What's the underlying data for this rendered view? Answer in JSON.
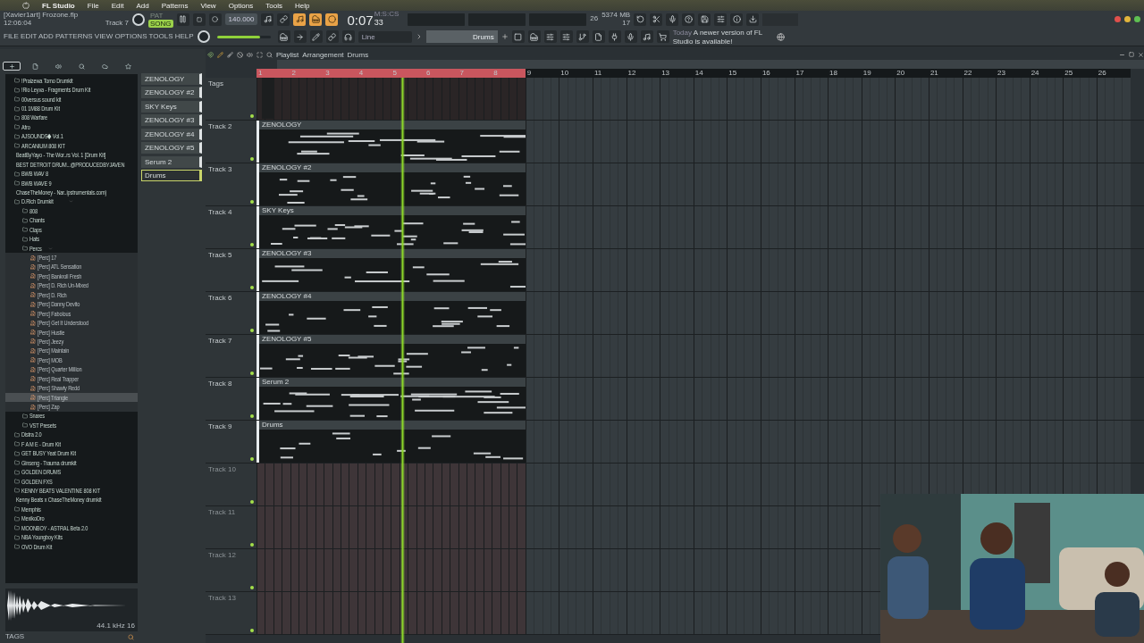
{
  "menubar": {
    "app": "FL Studio",
    "items": [
      "File",
      "Edit",
      "Add",
      "Patterns",
      "View",
      "Options",
      "Tools",
      "Help"
    ]
  },
  "toolbar": {
    "project": "[Xavier1art] Frozone.flp",
    "clock": "12:06:04",
    "hint": "Track 7",
    "modes": [
      {
        "label": "PAT",
        "selected": false
      },
      {
        "label": "SONG",
        "selected": true
      }
    ],
    "tempo": "140.000",
    "time_main": "0:07",
    "time_label": "M:S:CS",
    "time_sub": "33",
    "cpu": "26",
    "memory": "5374 MB",
    "polyphony": "17",
    "menu": [
      "FILE",
      "EDIT",
      "ADD",
      "PATTERNS",
      "VIEW",
      "OPTIONS",
      "TOOLS",
      "HELP"
    ],
    "master_volume": {
      "level": 0.8
    },
    "snap": "Line",
    "pattern": "Drums",
    "news_date": "Today",
    "news": "A newer version of FL Studio is available!"
  },
  "browser": {
    "tabs": [
      {
        "selected": true
      },
      {
        "selected": false
      },
      {
        "selected": false
      },
      {
        "selected": false
      },
      {
        "selected": false
      },
      {
        "selected": false
      }
    ],
    "items": [
      {
        "name": "!Praizewa Tomo Drumkit",
        "kind": "folder",
        "selected": false
      },
      {
        "name": "!Rio Leyva - Fragments Drum Kit",
        "kind": "folder",
        "selected": false
      },
      {
        "name": "00versus sound kit",
        "kind": "folder",
        "selected": false
      },
      {
        "name": "01 1M88 Drum Kit",
        "kind": "folder",
        "selected": false
      },
      {
        "name": "808 Warfare",
        "kind": "folder",
        "selected": false
      },
      {
        "name": "Afro",
        "kind": "folder",
        "selected": false
      },
      {
        "name": "AJSOUNDS◆ Vol.1",
        "kind": "folder",
        "selected": false
      },
      {
        "name": "ARCANIUM 808 KIT",
        "kind": "folder",
        "selected": false
      },
      {
        "name": "BeatByYayo - The Wor..rs Vol. 1 [Drum Kit]",
        "kind": "folder",
        "selected": false
      },
      {
        "name": "BEST DETROIT DRUM...@PRODUCEDBYJAVEN",
        "kind": "folder",
        "selected": false
      },
      {
        "name": "BWB WAV 8",
        "kind": "folder",
        "selected": false
      },
      {
        "name": "BWB WAVE 9",
        "kind": "folder",
        "selected": false
      },
      {
        "name": "ChaseTheMoney - Nar..ipstrumentals.com)",
        "kind": "folder",
        "selected": false
      },
      {
        "name": "D.Rich Drumkit",
        "kind": "folder",
        "expanded": true,
        "selected": false,
        "children": [
          {
            "name": "808",
            "kind": "folder",
            "selected": false
          },
          {
            "name": "Chants",
            "kind": "folder",
            "selected": false
          },
          {
            "name": "Claps",
            "kind": "folder",
            "selected": false
          },
          {
            "name": "Hats",
            "kind": "folder",
            "selected": false
          },
          {
            "name": "Percs",
            "kind": "folder",
            "expanded": true,
            "selected": false,
            "children": [
              {
                "name": "[Perc] 17",
                "kind": "file",
                "selected": false
              },
              {
                "name": "[Perc] ATL Sensation",
                "kind": "file",
                "selected": false
              },
              {
                "name": "[Perc] Bankroll Fresh",
                "kind": "file",
                "selected": false
              },
              {
                "name": "[Perc] D. Rich Un-Mixed",
                "kind": "file",
                "selected": false
              },
              {
                "name": "[Perc] D. Rich",
                "kind": "file",
                "selected": false
              },
              {
                "name": "[Perc] Danny Devito",
                "kind": "file",
                "selected": false
              },
              {
                "name": "[Perc] Fabolous",
                "kind": "file",
                "selected": false
              },
              {
                "name": "[Perc] Get It Understood",
                "kind": "file",
                "selected": false
              },
              {
                "name": "[Perc] Hustle",
                "kind": "file",
                "selected": false
              },
              {
                "name": "[Perc] Jeezy",
                "kind": "file",
                "selected": false
              },
              {
                "name": "[Perc] Maintain",
                "kind": "file",
                "selected": false
              },
              {
                "name": "[Perc] MOB",
                "kind": "file",
                "selected": false
              },
              {
                "name": "[Perc] Quarter Million",
                "kind": "file",
                "selected": false
              },
              {
                "name": "[Perc] Real Trapper",
                "kind": "file",
                "selected": false
              },
              {
                "name": "[Perc] Shawty Redd",
                "kind": "file",
                "selected": false
              },
              {
                "name": "[Perc] Triangle",
                "kind": "file",
                "selected": true
              },
              {
                "name": "[Perc] Zap",
                "kind": "file",
                "selected": false
              }
            ]
          },
          {
            "name": "Snares",
            "kind": "folder",
            "selected": false
          },
          {
            "name": "VST Presets",
            "kind": "folder",
            "selected": false
          }
        ]
      },
      {
        "name": "Distra 2.0",
        "kind": "folder",
        "selected": false
      },
      {
        "name": "F A M E - Drum Kit",
        "kind": "folder",
        "selected": false
      },
      {
        "name": "GET BUSY Yeat Drum Kit",
        "kind": "folder",
        "selected": false
      },
      {
        "name": "Ginseng - Trauma drumkit",
        "kind": "folder",
        "selected": false
      },
      {
        "name": "GOLDEN DRUMS",
        "kind": "folder",
        "selected": false
      },
      {
        "name": "GOLDEN FXS",
        "kind": "folder",
        "selected": false
      },
      {
        "name": "KENNY BEATS VALENTINE 808 KIT",
        "kind": "folder",
        "selected": false
      },
      {
        "name": "Kenny Beats x ChaseTheMoney drumkit",
        "kind": "folder",
        "selected": false
      },
      {
        "name": "Memphis",
        "kind": "folder",
        "selected": false
      },
      {
        "name": "MexikoDro",
        "kind": "folder",
        "selected": false
      },
      {
        "name": "MOONBOY - ASTRAL Beta 2.0",
        "kind": "folder",
        "selected": false
      },
      {
        "name": "NBA Youngboy Kits",
        "kind": "folder",
        "selected": false
      },
      {
        "name": "OVO Drum Kit",
        "kind": "folder",
        "selected": false
      }
    ],
    "format": "44.1 kHz 16",
    "tags": "TAGS"
  },
  "patterns": [
    {
      "name": "ZENOLOGY",
      "selected": false
    },
    {
      "name": "ZENOLOGY #2",
      "selected": false
    },
    {
      "name": "SKY Keys",
      "selected": false
    },
    {
      "name": "ZENOLOGY #3",
      "selected": false
    },
    {
      "name": "ZENOLOGY #4",
      "selected": false
    },
    {
      "name": "ZENOLOGY #5",
      "selected": false
    },
    {
      "name": "Serum 2",
      "selected": false
    },
    {
      "name": "Drums",
      "selected": true
    }
  ],
  "playlist": {
    "breadcrumb": [
      "Playlist",
      "Arrangement",
      "Drums"
    ],
    "ruler": [
      "1",
      "2",
      "3",
      "4",
      "5",
      "6",
      "7",
      "8",
      "9",
      "10",
      "11",
      "12",
      "13",
      "14",
      "15",
      "16",
      "17",
      "18",
      "19",
      "20",
      "21",
      "22",
      "23",
      "24",
      "25",
      "26"
    ],
    "playhead": {
      "level": 0.165
    },
    "tracks": [
      {
        "name": "Tags",
        "enabled": true,
        "clip": {
          "kind": "automation"
        }
      },
      {
        "name": "Track 2",
        "enabled": true,
        "clip": {
          "kind": "pattern",
          "name": "ZENOLOGY"
        }
      },
      {
        "name": "Track 3",
        "enabled": true,
        "clip": {
          "kind": "pattern",
          "name": "ZENOLOGY #2"
        }
      },
      {
        "name": "Track 4",
        "enabled": true,
        "clip": {
          "kind": "pattern",
          "name": "SKY Keys"
        }
      },
      {
        "name": "Track 5",
        "enabled": true,
        "clip": {
          "kind": "pattern",
          "name": "ZENOLOGY #3"
        }
      },
      {
        "name": "Track 6",
        "enabled": true,
        "clip": {
          "kind": "pattern",
          "name": "ZENOLOGY #4"
        }
      },
      {
        "name": "Track 7",
        "enabled": true,
        "clip": {
          "kind": "pattern",
          "name": "ZENOLOGY #5"
        }
      },
      {
        "name": "Track 8",
        "enabled": true,
        "clip": {
          "kind": "pattern",
          "name": "Serum 2"
        }
      },
      {
        "name": "Track 9",
        "enabled": true,
        "clip": {
          "kind": "pattern",
          "name": "Drums"
        }
      },
      {
        "name": "Track 10",
        "enabled": true
      },
      {
        "name": "Track 11",
        "enabled": true
      },
      {
        "name": "Track 12",
        "enabled": true
      },
      {
        "name": "Track 13",
        "enabled": true
      }
    ]
  }
}
